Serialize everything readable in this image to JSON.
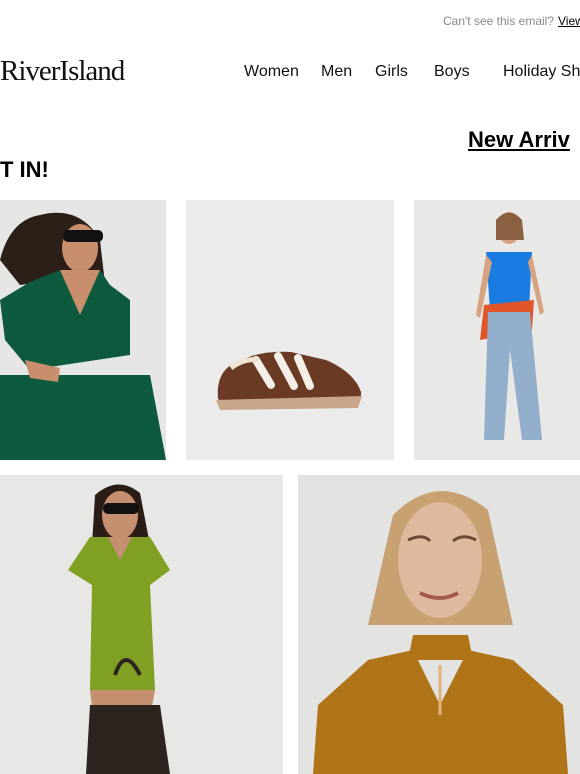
{
  "preheader": {
    "text": "Can't see this email?",
    "link": "View"
  },
  "brand": {
    "logo": "RiverIsland"
  },
  "nav": {
    "items": [
      "Women",
      "Men",
      "Girls",
      "Boys",
      "Holiday Sh"
    ]
  },
  "headline": {
    "link": "New Arriv",
    "section": "T IN!"
  },
  "products": [
    {
      "icon": "model-green-wrap-top-image",
      "color": "#0e5a3e"
    },
    {
      "icon": "brown-suede-sneaker-image",
      "color": "#6b3a25"
    },
    {
      "icon": "model-blue-top-jeans-image",
      "color": "#1a7ce0"
    },
    {
      "icon": "model-olive-dress-image",
      "color": "#7fa023"
    },
    {
      "icon": "model-mustard-satin-blouse-image",
      "color": "#b07418"
    }
  ]
}
